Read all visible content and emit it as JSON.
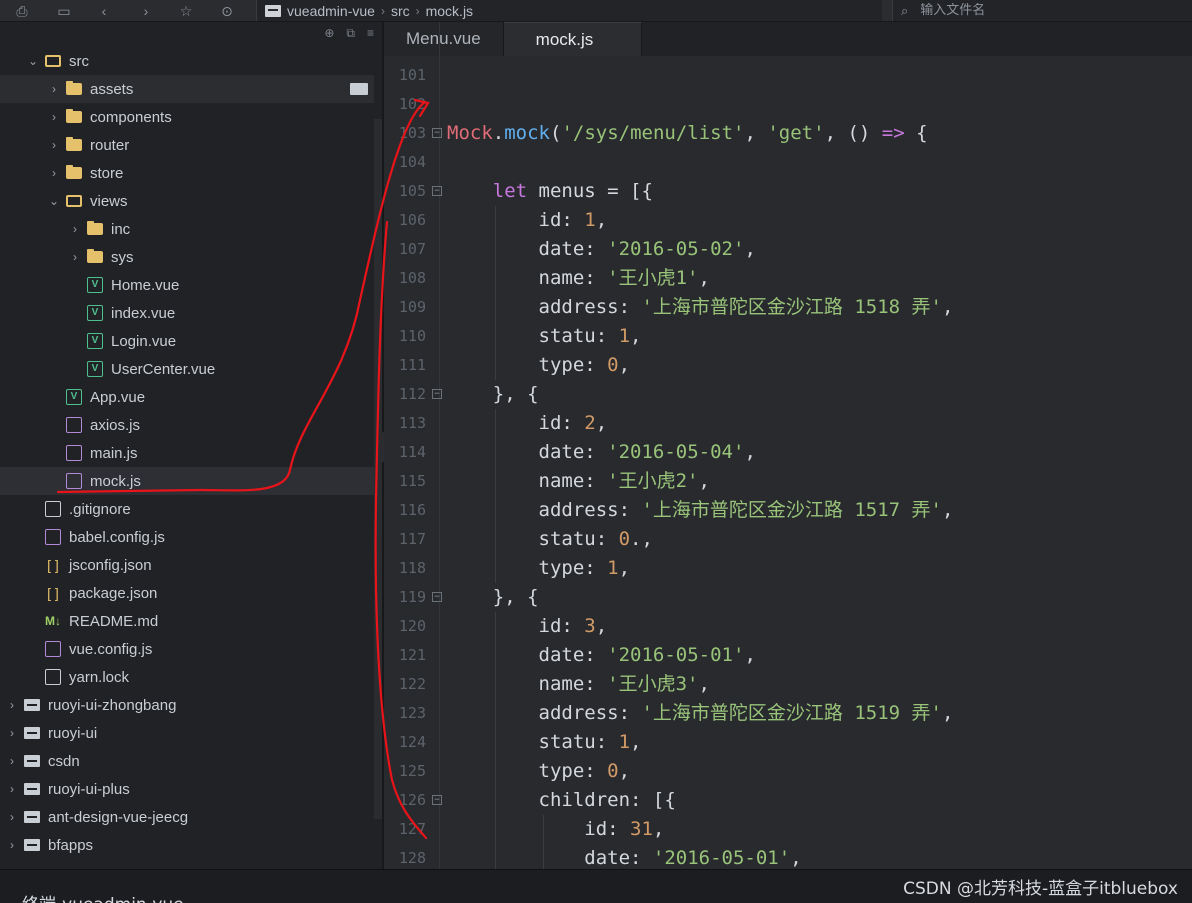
{
  "toolbar": {
    "breadcrumb": [
      "vueadmin-vue",
      "src",
      "mock.js"
    ],
    "search_placeholder": "输入文件名",
    "icons": [
      "save-icon",
      "file-icon",
      "back-icon",
      "forward-icon",
      "star-icon",
      "run-icon"
    ]
  },
  "sidebar": {
    "rows": [
      {
        "label": "src",
        "type": "folder-open",
        "expanded": true
      },
      {
        "label": "assets",
        "type": "folder",
        "expanded": false
      },
      {
        "label": "components",
        "type": "folder",
        "expanded": false
      },
      {
        "label": "router",
        "type": "folder",
        "expanded": false
      },
      {
        "label": "store",
        "type": "folder",
        "expanded": false
      },
      {
        "label": "views",
        "type": "folder-open",
        "expanded": true
      },
      {
        "label": "inc",
        "type": "folder",
        "expanded": false
      },
      {
        "label": "sys",
        "type": "folder",
        "expanded": false
      },
      {
        "label": "Home.vue",
        "type": "vue"
      },
      {
        "label": "index.vue",
        "type": "vue"
      },
      {
        "label": "Login.vue",
        "type": "vue"
      },
      {
        "label": "UserCenter.vue",
        "type": "vue"
      },
      {
        "label": "App.vue",
        "type": "vue"
      },
      {
        "label": "axios.js",
        "type": "js"
      },
      {
        "label": "main.js",
        "type": "js"
      },
      {
        "label": "mock.js",
        "type": "js",
        "selected": true
      },
      {
        "label": ".gitignore",
        "type": "file"
      },
      {
        "label": "babel.config.js",
        "type": "js"
      },
      {
        "label": "jsconfig.json",
        "type": "json"
      },
      {
        "label": "package.json",
        "type": "json"
      },
      {
        "label": "README.md",
        "type": "md"
      },
      {
        "label": "vue.config.js",
        "type": "js"
      },
      {
        "label": "yarn.lock",
        "type": "file"
      },
      {
        "label": "ruoyi-ui-zhongbang",
        "type": "repo"
      },
      {
        "label": "ruoyi-ui",
        "type": "repo"
      },
      {
        "label": "csdn",
        "type": "repo"
      },
      {
        "label": "ruoyi-ui-plus",
        "type": "repo"
      },
      {
        "label": "ant-design-vue-jeecg",
        "type": "repo"
      },
      {
        "label": "bfapps",
        "type": "repo"
      }
    ]
  },
  "editor": {
    "tabs": [
      "Menu.vue",
      "mock.js"
    ],
    "active_tab": "mock.js",
    "lines": [
      {
        "n": "101",
        "code": ""
      },
      {
        "n": "102",
        "code": ""
      },
      {
        "n": "103",
        "code": "Mock.mock('/sys/menu/list', 'get', () => {",
        "fold": true
      },
      {
        "n": "104",
        "code": ""
      },
      {
        "n": "105",
        "code": "    let menus = [{",
        "fold": true
      },
      {
        "n": "106",
        "code": "        id: 1,"
      },
      {
        "n": "107",
        "code": "        date: '2016-05-02',"
      },
      {
        "n": "108",
        "code": "        name: '王小虎1',"
      },
      {
        "n": "109",
        "code": "        address: '上海市普陀区金沙江路 1518 弄',"
      },
      {
        "n": "110",
        "code": "        statu: 1,"
      },
      {
        "n": "111",
        "code": "        type: 0,"
      },
      {
        "n": "112",
        "code": "    }, {",
        "fold": true
      },
      {
        "n": "113",
        "code": "        id: 2,"
      },
      {
        "n": "114",
        "code": "        date: '2016-05-04',"
      },
      {
        "n": "115",
        "code": "        name: '王小虎2',"
      },
      {
        "n": "116",
        "code": "        address: '上海市普陀区金沙江路 1517 弄',"
      },
      {
        "n": "117",
        "code": "        statu: 0.,"
      },
      {
        "n": "118",
        "code": "        type: 1,"
      },
      {
        "n": "119",
        "code": "    }, {",
        "fold": true
      },
      {
        "n": "120",
        "code": "        id: 3,"
      },
      {
        "n": "121",
        "code": "        date: '2016-05-01',"
      },
      {
        "n": "122",
        "code": "        name: '王小虎3',"
      },
      {
        "n": "123",
        "code": "        address: '上海市普陀区金沙江路 1519 弄',"
      },
      {
        "n": "124",
        "code": "        statu: 1,"
      },
      {
        "n": "125",
        "code": "        type: 0,"
      },
      {
        "n": "126",
        "code": "        children: [{",
        "fold": true
      },
      {
        "n": "127",
        "code": "            id: 31,"
      },
      {
        "n": "128",
        "code": "            date: '2016-05-01',"
      }
    ]
  },
  "bottom": {
    "terminal_label": "终端-vueadmin-vue",
    "watermark": "CSDN @北芳科技-蓝盒子itbluebox"
  },
  "colors": {
    "keyword": "#c678dd",
    "entity": "#e06c75",
    "function": "#61afef",
    "string": "#98c379",
    "number": "#d19a66",
    "annotation": "#e8141a"
  }
}
